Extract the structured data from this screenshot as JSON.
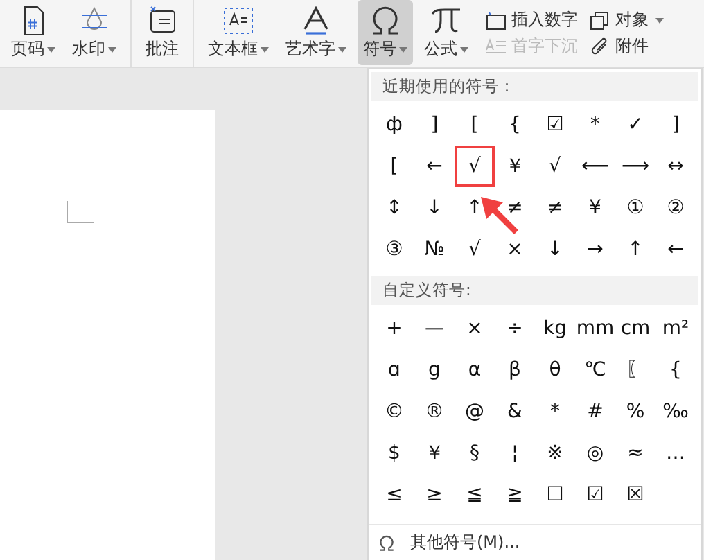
{
  "toolbar": {
    "large_tools": [
      {
        "label": "页码",
        "caret": true,
        "selected": false
      },
      {
        "label": "水印",
        "caret": true,
        "selected": false
      },
      {
        "label": "批注",
        "caret": false,
        "selected": false
      },
      {
        "label": "文本框",
        "caret": true,
        "selected": false
      },
      {
        "label": "艺术字",
        "caret": true,
        "selected": false
      },
      {
        "label": "符号",
        "caret": true,
        "selected": true
      },
      {
        "label": "公式",
        "caret": true,
        "selected": false
      }
    ],
    "small_tools": [
      {
        "label": "插入数字",
        "caret": false,
        "disabled": false
      },
      {
        "label": "首字下沉",
        "caret": false,
        "disabled": true
      },
      {
        "label": "对象",
        "caret": true,
        "disabled": false
      },
      {
        "label": "附件",
        "caret": false,
        "disabled": false
      }
    ]
  },
  "symbol_panel": {
    "recent_title": "近期使用的符号：",
    "recent_symbols": [
      {
        "symbol": "ф",
        "highlighted": false
      },
      {
        "symbol": "]",
        "highlighted": false
      },
      {
        "symbol": "[",
        "highlighted": false
      },
      {
        "symbol": "{",
        "highlighted": false
      },
      {
        "symbol": "☑",
        "highlighted": false
      },
      {
        "symbol": "*",
        "highlighted": false
      },
      {
        "symbol": "✓",
        "highlighted": false
      },
      {
        "symbol": "]",
        "highlighted": false
      },
      {
        "symbol": "[",
        "highlighted": false
      },
      {
        "symbol": "←",
        "highlighted": false
      },
      {
        "symbol": "√",
        "highlighted": true
      },
      {
        "symbol": "￥",
        "highlighted": false
      },
      {
        "symbol": "√",
        "highlighted": false
      },
      {
        "symbol": "⟵",
        "highlighted": false
      },
      {
        "symbol": "⟶",
        "highlighted": false
      },
      {
        "symbol": "↔",
        "highlighted": false
      },
      {
        "symbol": "↕",
        "highlighted": false
      },
      {
        "symbol": "↓",
        "highlighted": false
      },
      {
        "symbol": "↑",
        "highlighted": false
      },
      {
        "symbol": "≠",
        "highlighted": false
      },
      {
        "symbol": "≠",
        "highlighted": false
      },
      {
        "symbol": "¥",
        "highlighted": false
      },
      {
        "symbol": "①",
        "highlighted": false
      },
      {
        "symbol": "②",
        "highlighted": false
      },
      {
        "symbol": "③",
        "highlighted": false
      },
      {
        "symbol": "№",
        "highlighted": false
      },
      {
        "symbol": "√",
        "highlighted": false
      },
      {
        "symbol": "×",
        "highlighted": false
      },
      {
        "symbol": "↓",
        "highlighted": false
      },
      {
        "symbol": "→",
        "highlighted": false
      },
      {
        "symbol": "↑",
        "highlighted": false
      },
      {
        "symbol": "←",
        "highlighted": false
      }
    ],
    "custom_title": "自定义符号:",
    "custom_symbols": [
      "+",
      "—",
      "×",
      "÷",
      "kg",
      "mm",
      "cm",
      "m²",
      "ɑ",
      "g",
      "α",
      "β",
      "θ",
      "℃",
      "〖",
      "{",
      "©",
      "®",
      "@",
      "&",
      "*",
      "#",
      "%",
      "‰",
      "$",
      "￥",
      "§",
      "¦",
      "※",
      "◎",
      "≈",
      "…",
      "≤",
      "≥",
      "≦",
      "≧",
      "☐",
      "☑",
      "☒"
    ],
    "more_label": "其他符号(M)..."
  }
}
